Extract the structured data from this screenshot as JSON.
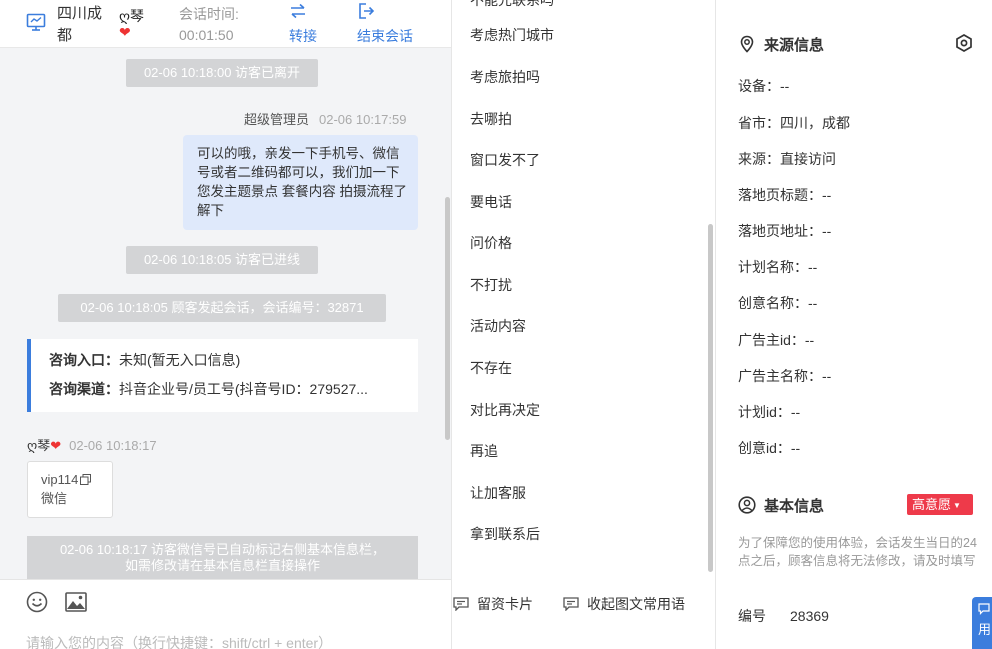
{
  "header": {
    "location": "四川成都",
    "visitor_name": "ღ琴",
    "heart": "❤",
    "session_time_label": "会话时间:",
    "session_time_value": "00:01:50",
    "transfer_label": "转接",
    "end_label": "结束会话"
  },
  "chat": {
    "pill_left": "02-06 10:18:00 访客已离开",
    "agent_name": "超级管理员",
    "agent_time": "02-06 10:17:59",
    "agent_message": "可以的哦，亲发一下手机号、微信号或者二维码都可以，我们加一下您发主题景点 套餐内容 拍摄流程了解下",
    "pill_enter": "02-06 10:18:05 访客已进线",
    "pill_session": "02-06 10:18:05 顾客发起会话，会话编号：32871",
    "entry_label": "咨询入口：",
    "entry_value": "未知(暂无入口信息)",
    "channel_label": "咨询渠道：",
    "channel_value": "抖音企业号/员工号(抖音号ID：279527...",
    "visitor_time": "02-06 10:18:17",
    "visitor_line1": "vip114",
    "visitor_line2": "微信",
    "auto_notice_line1": "02-06 10:18:17 访客微信号已自动标记右侧基本信息栏，",
    "auto_notice_line2": "如需修改请在基本信息栏直接操作",
    "input_placeholder": "请输入您的内容（换行快捷键：shift/ctrl + enter）"
  },
  "phrases": {
    "top_clipped": "不能先联系吗",
    "items": [
      "考虑热门城市",
      "考虑旅拍吗",
      "去哪拍",
      "窗口发不了",
      "要电话",
      "问价格",
      "不打扰",
      "活动内容",
      "不存在",
      "对比再决定",
      "再追",
      "让加客服",
      "拿到联系后"
    ],
    "card_button": "留资卡片",
    "phrases_button": "收起图文常用语"
  },
  "source_info": {
    "title": "来源信息",
    "device": "设备：--",
    "province": "省市：四川，成都",
    "source": "来源：直接访问",
    "landing_title": "落地页标题：--",
    "landing_url": "落地页地址：--",
    "plan_name": "计划名称：--",
    "creative_name": "创意名称：--",
    "advertiser_id": "广告主id：--",
    "advertiser_name": "广告主名称：--",
    "plan_id": "计划id：--",
    "creative_id": "创意id：--"
  },
  "basic_info": {
    "title": "基本信息",
    "intent_badge": "高意愿",
    "note": "为了保障您的使用体验，会话发生当日的24点之后，顾客信息将无法修改，请及时填写",
    "number_label": "编号",
    "number_value": "28369"
  },
  "float_button": "用",
  "colors": {
    "accent": "#3b7ddd",
    "badge_red": "#ee3a4a",
    "bubble_agent": "#dfe9fb",
    "system_pill": "#d3d4d6"
  }
}
